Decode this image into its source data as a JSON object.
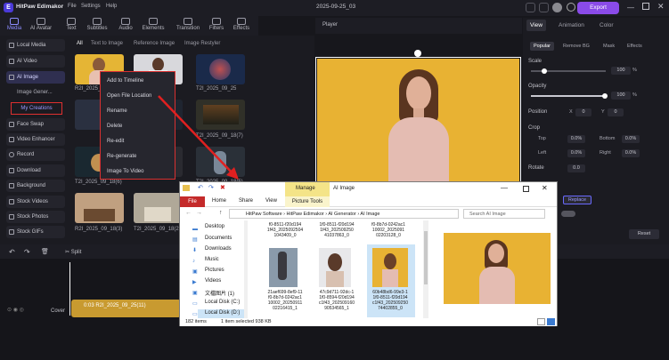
{
  "app": {
    "name": "HitPaw Edimakor",
    "project": "2025-09-25_03",
    "menus": [
      "File",
      "Settings",
      "Help"
    ],
    "export_label": "Export"
  },
  "toolbar": {
    "items": [
      "Media",
      "AI Avatar",
      "Text",
      "Subtitles",
      "Audio",
      "Elements",
      "Transition",
      "Filters",
      "Effects"
    ]
  },
  "nav": {
    "items": [
      "Local Media",
      "AI Video",
      "AI Image"
    ],
    "sub_items": [
      "Image Gener...",
      "My Creations"
    ],
    "items2": [
      "Face Swap",
      "Video Enhancer",
      "Record",
      "Download",
      "Background",
      "Stock Videos",
      "Stock Photos",
      "Stock GIFs"
    ]
  },
  "library": {
    "tabs": [
      "All",
      "Text to Image",
      "Reference Image",
      "Image Restyler"
    ],
    "thumb_labels": [
      "R2I_2025_09_1",
      "",
      "T2I_2025_09_25",
      "",
      "T2I_2025_09_18(7)",
      "T2I_2025_09_18(6)",
      "T2I_2025_09_18(5)",
      "R2I_2025_09_18(3)",
      "T2I_2025_09_18(2)"
    ]
  },
  "context_menu": {
    "items": [
      "Add to Timeline",
      "Open File Location",
      "Rename",
      "Delete",
      "Re-edit",
      "Re-generate",
      "Image To Video"
    ]
  },
  "player": {
    "label": "Player"
  },
  "right_panel": {
    "tabs": [
      "View",
      "Animation",
      "Color"
    ],
    "subtabs": [
      "Popular",
      "Remove BG",
      "Mask",
      "Effects"
    ],
    "scale_label": "Scale",
    "scale_value": "100",
    "scale_unit": "%",
    "opacity_label": "Opacity",
    "opacity_value": "100",
    "opacity_unit": "%",
    "position_label": "Position",
    "pos_x_label": "X",
    "pos_x": "0",
    "pos_y_label": "Y",
    "pos_y": "0",
    "crop_label": "Crop",
    "crop_top_label": "Top",
    "crop_top": "0.0%",
    "crop_bottom_label": "Bottom",
    "crop_bottom": "0.0%",
    "crop_left_label": "Left",
    "crop_left": "0.0%",
    "crop_right_label": "Right",
    "crop_right": "0.0%",
    "rotate_label": "Rotate",
    "rotate_value": "0.0",
    "replace_label": "Replace",
    "reset_label": "Reset"
  },
  "timeline": {
    "split_label": "Split",
    "cover_label": "Cover",
    "clip_label": "0:03 R2I_2025_09_25(11)"
  },
  "explorer": {
    "title": "AI Image",
    "manage_tab": "Manage",
    "ribbon_tabs": [
      "File",
      "Home",
      "Share",
      "View",
      "Picture Tools"
    ],
    "breadcrumb": [
      "HitPaw Software",
      "HitPaw Edimakor",
      "AI Generator",
      "AI Image"
    ],
    "search_placeholder": "Search AI Image",
    "sidebar": [
      "Desktop",
      "Documents",
      "Downloads",
      "Music",
      "Pictures",
      "Videos",
      "文檔图片 (1)",
      "Local Disk (C:)",
      "Local Disk (D:)"
    ],
    "top_files": [
      "f0-8511-f20d194\n1f43_2025092504\n1043409_0",
      "1f0-8511-f20d194\n1f43_202509250\n41037863_0",
      "f0-8b7d-0242ac1\n10002_2025091\n02203128_0"
    ],
    "files": [
      "21aef699-8ef9-11\nf0-8b7d-0242ac1\n10002_20250911\n02216415_1",
      "47c9d711-92dc-1\n1f0-8594-f20d194\nc1f43_202509160\n90534565_1",
      "60b48bd6-99e3-1\n1f0-8511-f20d194\nc1f43_202509250\n74402855_0"
    ],
    "status_items": "182 items",
    "status_selected": "1 item selected  938 KB"
  }
}
